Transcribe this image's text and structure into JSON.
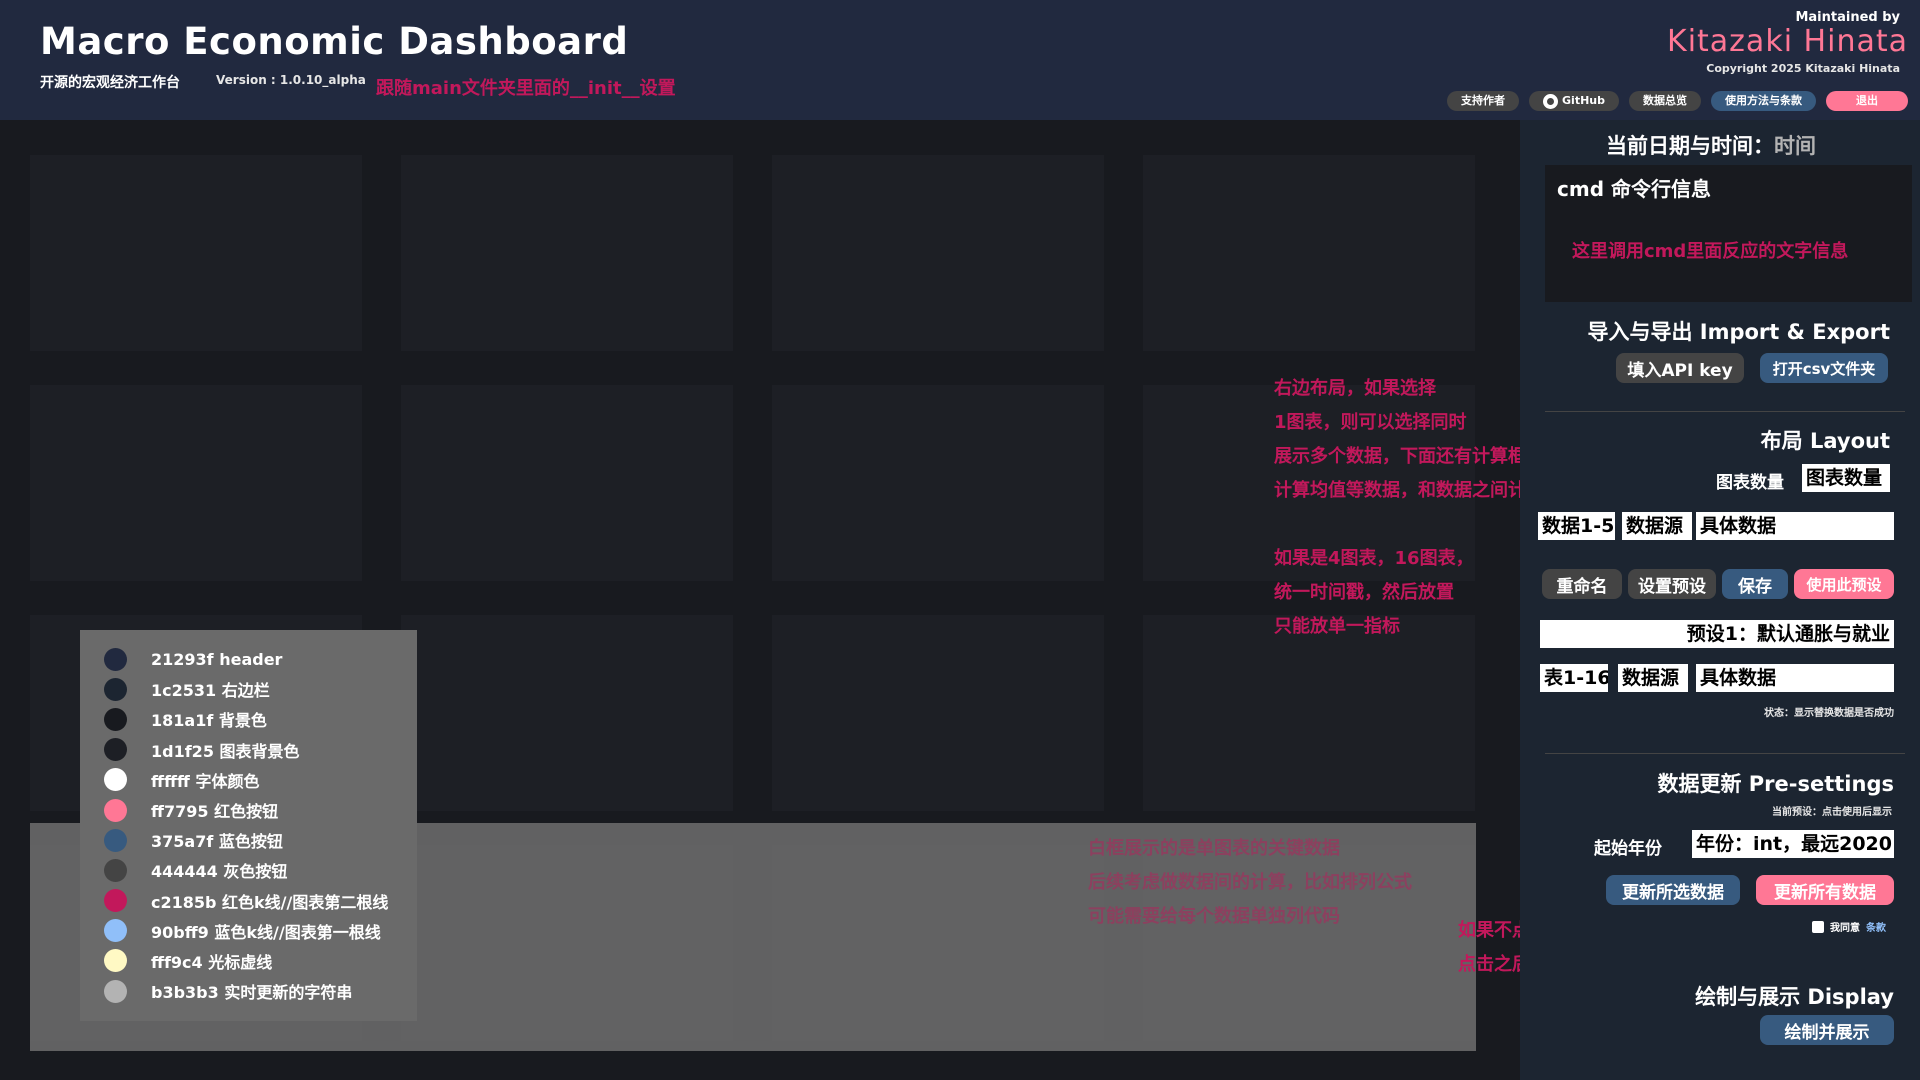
{
  "header": {
    "title": "Macro Economic Dashboard",
    "subtitle": "开源的宏观经济工作台",
    "version": "Version : 1.0.10_alpha",
    "init_note": "跟随main文件夹里面的__init__设置",
    "maintained_by": "Maintained by",
    "author": "Kitazaki Hinata",
    "copyright": "Copyright 2025 Kitazaki Hinata",
    "buttons": {
      "support": "支持作者",
      "github": "GitHub",
      "data_overview": "数据总览",
      "terms": "使用方法与条款",
      "exit": "退出"
    }
  },
  "palette": [
    {
      "color": "#21293f",
      "label": "21293f  header"
    },
    {
      "color": "#1c2531",
      "label": "1c2531  右边栏"
    },
    {
      "color": "#181a1f",
      "label": "181a1f  背景色"
    },
    {
      "color": "#1d1f25",
      "label": "1d1f25  图表背景色"
    },
    {
      "color": "#ffffff",
      "label": "ffffff  字体颜色"
    },
    {
      "color": "#ff7795",
      "label": "ff7795  红色按钮"
    },
    {
      "color": "#375a7f",
      "label": "375a7f  蓝色按钮"
    },
    {
      "color": "#444444",
      "label": "444444  灰色按钮"
    },
    {
      "color": "#c2185b",
      "label": "c2185b  红色k线//图表第二根线"
    },
    {
      "color": "#90bff9",
      "label": "90bff9  蓝色k线//图表第一根线"
    },
    {
      "color": "#fff9c4",
      "label": "fff9c4  光标虚线"
    },
    {
      "color": "#b3b3b3",
      "label": "b3b3b3  实时更新的字符串"
    }
  ],
  "notes": {
    "layout": [
      "右边布局，如果选择",
      "1图表，则可以选择同时",
      "展示多个数据，下面还有计算框",
      "计算均值等数据，和数据之间计算",
      "",
      "如果是4图表，16图表，",
      "统一时间戳，然后放置",
      "只能放单一指标"
    ],
    "key_data": [
      "白框展示的是单图表的关键数据",
      "后续考虑做数据间的计算，比如排列公式",
      "可能需要给每个数据单独列代码"
    ],
    "agree": [
      "如果不点击同意条款，则无法下载",
      "点击之后会生成不可改动的时间戳和哈希值"
    ]
  },
  "sidebar": {
    "datetime_label": "当前日期与时间：",
    "datetime_value": "时间",
    "cmd_title": "cmd 命令行信息",
    "cmd_msg": "这里调用cmd里面反应的文字信息",
    "import_export_title": "导入与导出 Import & Export",
    "api_key_btn": "填入API key",
    "open_csv_btn": "打开csv文件夹",
    "layout_title": "布局 Layout",
    "chart_count_label": "图表数量",
    "chart_count_value": "图表数量",
    "data_row1": [
      "数据1-5",
      "数据源",
      "具体数据"
    ],
    "rename_btn": "重命名",
    "preset_btn": "设置预设",
    "save_btn": "保存",
    "use_preset_btn": "使用此预设",
    "preset_value": "预设1：默认通胀与就业",
    "data_row2": [
      "表1-16",
      "数据源",
      "具体数据"
    ],
    "status": "状态：显示替换数据是否成功",
    "update_title": "数据更新 Pre-settings",
    "current_preset": "当前预设：点击使用后显示",
    "start_year_label": "起始年份",
    "start_year_value": "年份：int，最远2020",
    "update_selected_btn": "更新所选数据",
    "update_all_btn": "更新所有数据",
    "agree_text": "我同意",
    "agree_link": "条款",
    "display_title": "绘制与展示 Display",
    "draw_btn": "绘制并展示"
  }
}
